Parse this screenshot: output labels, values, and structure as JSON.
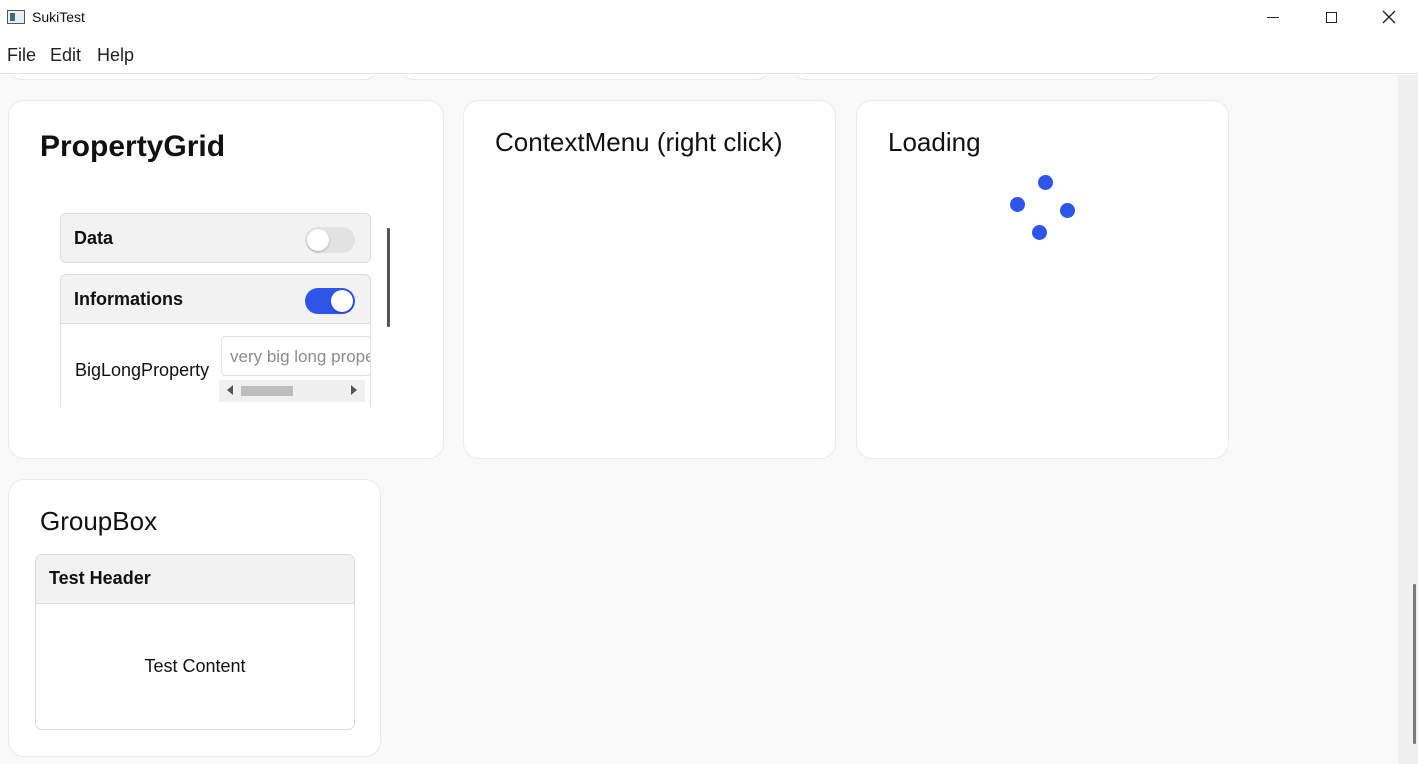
{
  "window": {
    "title": "SukiTest",
    "icon": "app-window-icon",
    "controls": [
      "minimize-icon",
      "maximize-icon",
      "close-icon"
    ]
  },
  "menu": {
    "items": [
      "File",
      "Edit",
      "Help"
    ]
  },
  "cards": {
    "property_grid": {
      "title": "PropertyGrid",
      "sections": [
        {
          "label": "Data",
          "toggle_on": false
        },
        {
          "label": "Informations",
          "toggle_on": true
        }
      ],
      "property": {
        "name": "BigLongProperty",
        "value": "very big long property"
      }
    },
    "context_menu": {
      "title": "ContextMenu (right click)"
    },
    "loading": {
      "title": "Loading"
    },
    "group_box": {
      "title": "GroupBox",
      "header": "Test Header",
      "content": "Test Content"
    }
  },
  "colors": {
    "accent": "#2f55e8",
    "background": "#f9f9f9",
    "card": "#ffffff"
  }
}
